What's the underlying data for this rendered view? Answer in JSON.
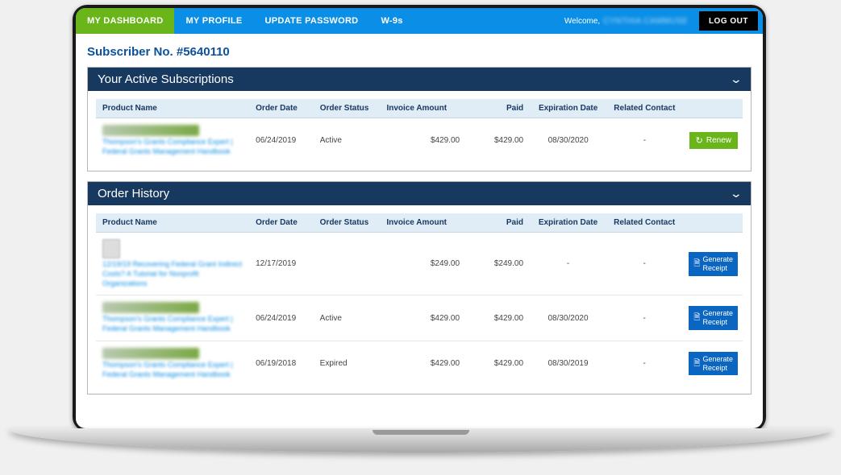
{
  "nav": {
    "items": [
      {
        "label": "MY DASHBOARD",
        "active": true
      },
      {
        "label": "MY PROFILE",
        "active": false
      },
      {
        "label": "UPDATE PASSWORD",
        "active": false
      },
      {
        "label": "W-9s",
        "active": false
      }
    ],
    "welcome_prefix": "Welcome,",
    "welcome_name": "CYNTHIA CAMMUSE",
    "logout_label": "LOG OUT"
  },
  "subscriber_line_prefix": "Subscriber No. ",
  "subscriber_number": "#5640110",
  "columns": {
    "product": "Product Name",
    "order_date": "Order Date",
    "order_status": "Order Status",
    "invoice_amount": "Invoice Amount",
    "paid": "Paid",
    "expiration_date": "Expiration Date",
    "related_contact": "Related Contact"
  },
  "panels": {
    "active": {
      "title": "Your Active Subscriptions",
      "rows": [
        {
          "product_logo": "THOMPSON GRANTS",
          "product_link": "Thompson's Grants Compliance Expert | Federal Grants Management Handbook",
          "order_date": "06/24/2019",
          "order_status": "Active",
          "invoice_amount": "$429.00",
          "paid": "$429.00",
          "expiration_date": "08/30/2020",
          "related_contact": "-",
          "action": "renew",
          "action_label": "Renew"
        }
      ]
    },
    "history": {
      "title": "Order History",
      "rows": [
        {
          "product_thumb": true,
          "product_link": "12/19/19 Recovering Federal Grant Indirect Costs? A Tutorial for Nonprofit Organizations",
          "order_date": "12/17/2019",
          "order_status": "",
          "invoice_amount": "$249.00",
          "paid": "$249.00",
          "expiration_date": "-",
          "related_contact": "-",
          "action": "receipt",
          "action_label": "Generate Receipt"
        },
        {
          "product_logo": "THOMPSON GRANTS",
          "product_link": "Thompson's Grants Compliance Expert | Federal Grants Management Handbook",
          "order_date": "06/24/2019",
          "order_status": "Active",
          "invoice_amount": "$429.00",
          "paid": "$429.00",
          "expiration_date": "08/30/2020",
          "related_contact": "-",
          "action": "receipt",
          "action_label": "Generate Receipt"
        },
        {
          "product_logo": "THOMPSON GRANTS",
          "product_link": "Thompson's Grants Compliance Expert | Federal Grants Management Handbook",
          "order_date": "06/19/2018",
          "order_status": "Expired",
          "invoice_amount": "$429.00",
          "paid": "$429.00",
          "expiration_date": "08/30/2019",
          "related_contact": "-",
          "action": "receipt",
          "action_label": "Generate Receipt"
        }
      ]
    }
  }
}
